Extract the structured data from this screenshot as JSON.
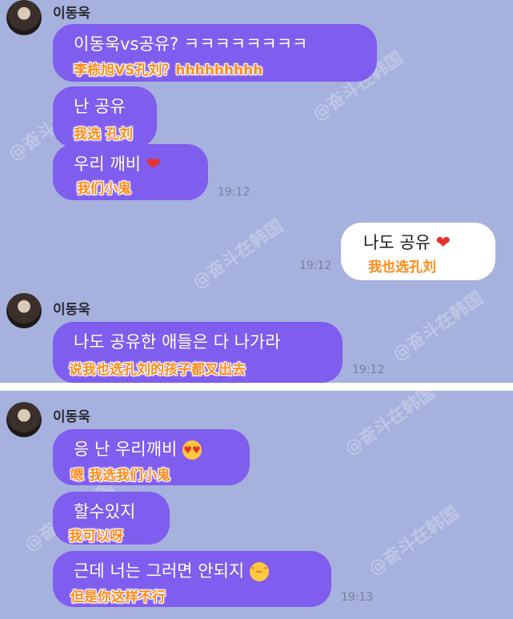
{
  "panel1": {
    "sender1": "이동욱",
    "m1": {
      "text": "이동욱vs공유? ㅋㅋㅋㅋㅋㅋㅋㅋ",
      "caption": "李栋旭VS孔刘？hhhhhhhhh"
    },
    "m2": {
      "text": "난 공유",
      "caption": "我选 孔刘"
    },
    "m3": {
      "text": "우리 깨비",
      "caption": "我们小鬼"
    },
    "time1": "19:12",
    "m4": {
      "text": "나도 공유",
      "caption": "我也选孔刘"
    },
    "time2": "19:12",
    "sender2": "이동욱",
    "m5": {
      "text": "나도 공유한 애들은 다 나가라",
      "caption": "说我也选孔刘的孩子都叉出去"
    },
    "time3": "19:12"
  },
  "panel2": {
    "sender": "이동욱",
    "m1": {
      "text": "응 난 우리깨비",
      "caption": "嗯 我选我们小鬼"
    },
    "m2": {
      "text": "할수있지",
      "caption": "我可以呀"
    },
    "m3": {
      "text": "근데 너는 그러면 안되지",
      "caption": "但是你这样不行"
    },
    "time": "19:13"
  },
  "watermark": "@奋斗在韩国",
  "icons": [
    "red-heart-emoji",
    "heart-eyes-emoji",
    "huffing-face-emoji"
  ],
  "colors": {
    "background": "#a7b1de",
    "incoming_bubble": "#7f5dee",
    "outgoing_bubble": "#ffffff",
    "caption": "#ff8a18",
    "heart": "#e8312a"
  }
}
